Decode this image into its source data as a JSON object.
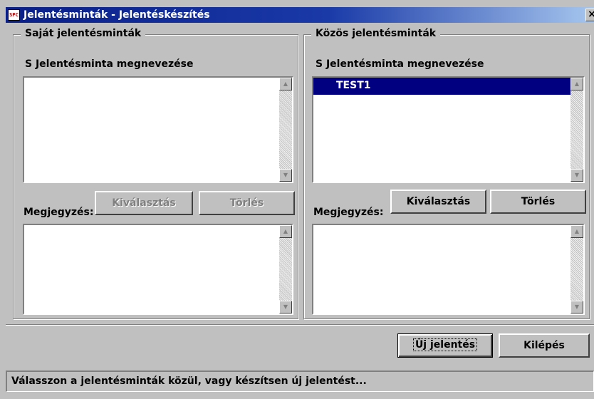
{
  "window": {
    "title": "Jelentésminták - Jelentéskészítés",
    "app_icon_text": "SPC",
    "close_glyph": "×"
  },
  "left_panel": {
    "group_title": "Saját jelentésminták",
    "column_header": "S  Jelentésminta megnevezése",
    "items": [],
    "note_label": "Megjegyzés:",
    "select_button": "Kiválasztás",
    "delete_button": "Törlés"
  },
  "right_panel": {
    "group_title": "Közös jelentésminták",
    "column_header": "S  Jelentésminta megnevezése",
    "items": [
      "TEST1"
    ],
    "selected_item": "TEST1",
    "note_label": "Megjegyzés:",
    "select_button": "Kiválasztás",
    "delete_button": "Törlés"
  },
  "footer": {
    "new_report_button": "Új jelentés",
    "exit_button": "Kilépés"
  },
  "status": {
    "text": "Válasszon a jelentésminták közül, vagy készítsen új jelentést..."
  },
  "scroll": {
    "up_glyph": "▲",
    "down_glyph": "▼"
  }
}
